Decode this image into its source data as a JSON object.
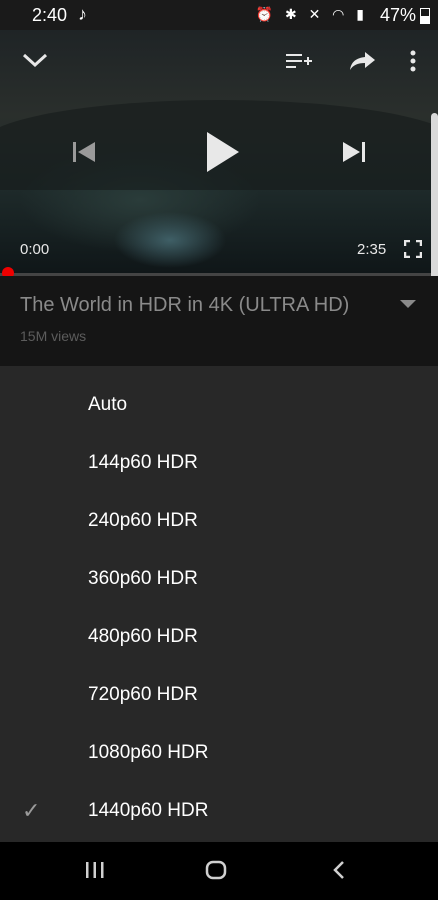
{
  "status_bar": {
    "time": "2:40",
    "battery": "47%"
  },
  "player": {
    "current_time": "0:00",
    "duration": "2:35",
    "progress": 0.0
  },
  "video": {
    "title": "The World in HDR in 4K (ULTRA HD)",
    "views": "15M views"
  },
  "quality_menu": {
    "options": [
      "Auto",
      "144p60 HDR",
      "240p60 HDR",
      "360p60 HDR",
      "480p60 HDR",
      "720p60 HDR",
      "1080p60 HDR",
      "1440p60 HDR"
    ],
    "selected": "1440p60 HDR"
  }
}
